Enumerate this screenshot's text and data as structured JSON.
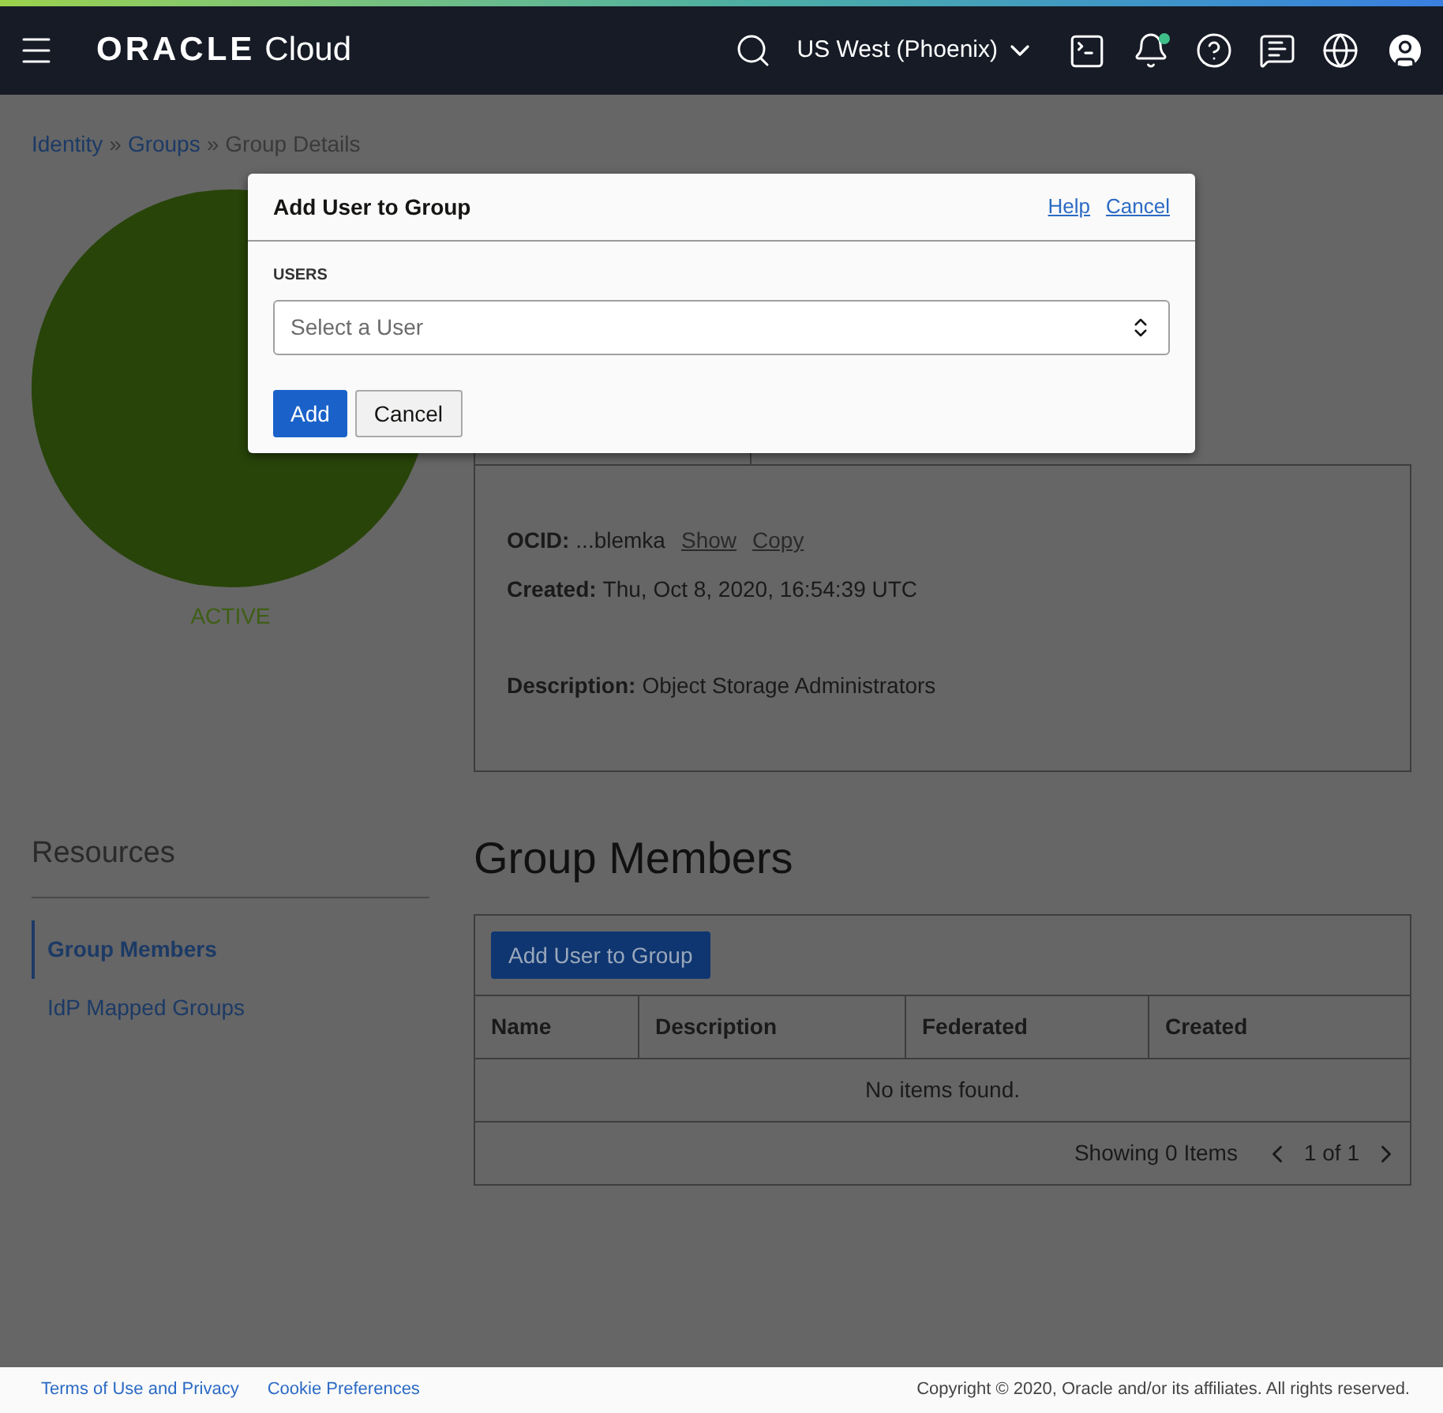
{
  "header": {
    "logo_brand": "ORACLE",
    "logo_product": "Cloud",
    "region": "US West (Phoenix)",
    "notifications_unread": true
  },
  "breadcrumb": [
    {
      "label": "Identity",
      "link": true
    },
    {
      "label": "»",
      "link": false
    },
    {
      "label": "Groups",
      "link": true
    },
    {
      "label": "»",
      "link": false
    },
    {
      "label": "Group Details",
      "link": false
    }
  ],
  "group": {
    "status": "ACTIVE",
    "color": "#284409"
  },
  "details": [
    {
      "label": "OCID:",
      "value": "...blemka",
      "links": [
        "Show",
        "Copy"
      ]
    },
    {
      "label": "Created:",
      "value": "Thu, Oct 8, 2020, 16:54:39 UTC"
    },
    {
      "label": "Description:",
      "value": "Object Storage Administrators"
    }
  ],
  "resources": {
    "title": "Resources",
    "items": [
      {
        "label": "Group Members",
        "selected": true
      },
      {
        "label": "IdP Mapped Groups",
        "selected": false
      }
    ]
  },
  "members": {
    "title": "Group Members",
    "add_button": "Add User to Group",
    "columns": [
      "Name",
      "Description",
      "Federated",
      "Created"
    ],
    "empty": "No items found.",
    "showing": "Showing 0 Items",
    "page": "1 of 1"
  },
  "dialog": {
    "title": "Add User to Group",
    "links": [
      "Help",
      "Cancel"
    ],
    "field_label": "USERS",
    "placeholder": "Select a User",
    "buttons": [
      {
        "label": "Add",
        "primary": true
      },
      {
        "label": "Cancel",
        "primary": false
      }
    ]
  },
  "footer": {
    "links": [
      "Terms of Use and Privacy",
      "Cookie Preferences"
    ],
    "copyright": "Copyright © 2020, Oracle and/or its affiliates. All rights reserved."
  }
}
